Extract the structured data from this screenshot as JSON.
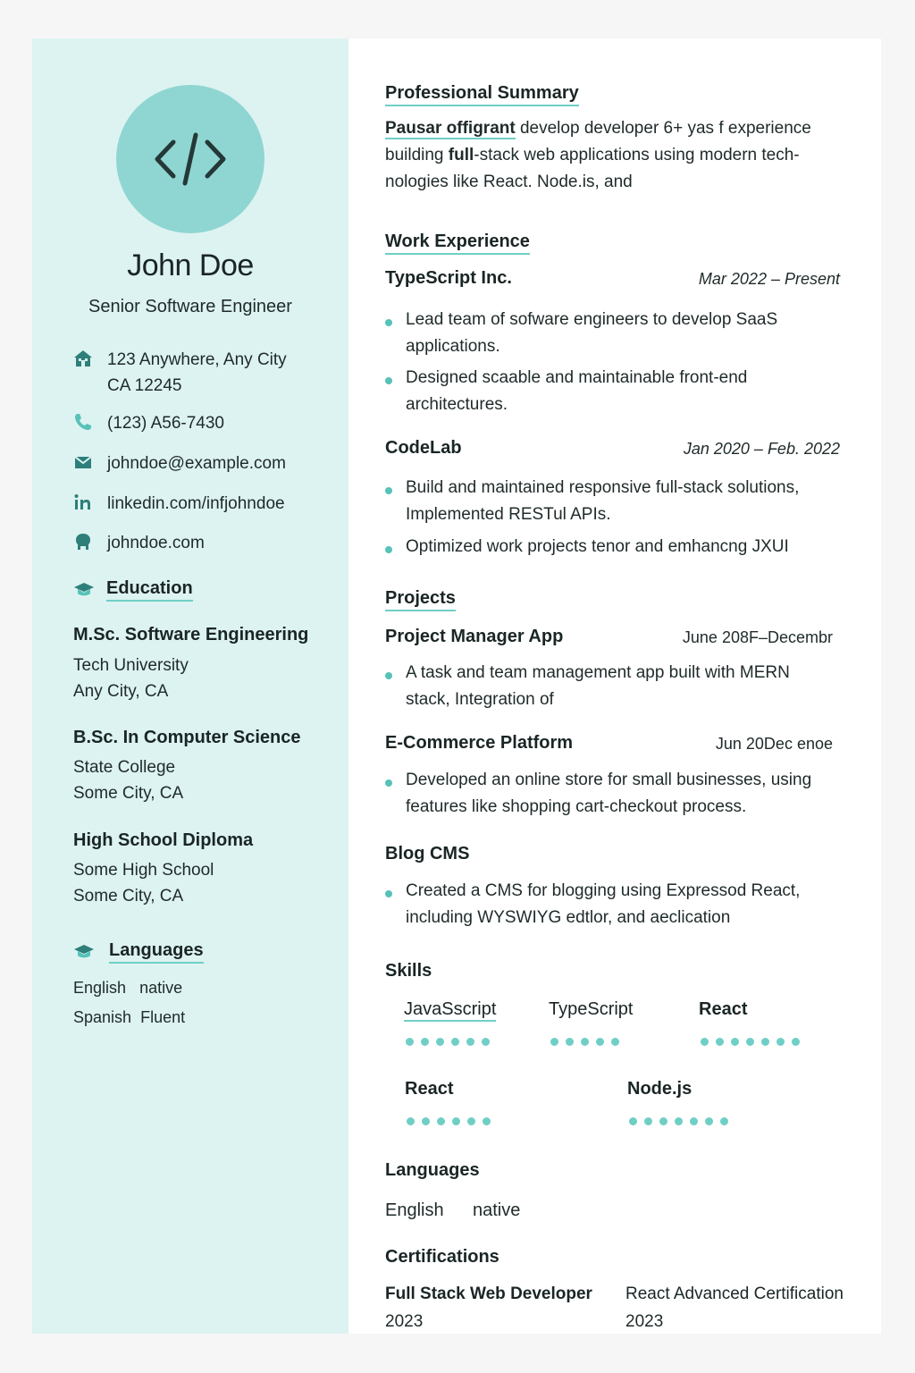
{
  "profile": {
    "name": "John Doe",
    "title": "Senior Software Engineer",
    "avatar_icon": "code-brackets-icon"
  },
  "contact": {
    "address_line1": "123 Anywhere, Any City",
    "address_line2": "CA 12245",
    "phone": "(123) A56-7430",
    "email": "johndoe@example.com",
    "linkedin": "linkedin.com/infjohndoe",
    "website": "johndoe.com"
  },
  "education": {
    "heading": "Education",
    "items": [
      {
        "degree": "M.Sc. Software Engineering",
        "school": "Tech University",
        "location": "Any City, CA"
      },
      {
        "degree": "B.Sc. In Computer Science",
        "school": "State College",
        "location": "Some City, CA"
      },
      {
        "degree": "High School Diploma",
        "school": "Some High School",
        "location": "Some City, CA"
      }
    ]
  },
  "side_languages": {
    "heading": "Languages",
    "items": [
      {
        "language": "English",
        "level": "native"
      },
      {
        "language": "Spanish",
        "level": "Fluent"
      }
    ]
  },
  "summary": {
    "heading": "Professional Summary",
    "highlight": "Pausar offigrant",
    "line1_rest": " develop developer 6+ yas f experience",
    "line2_pre": "building ",
    "line2_bold": "full",
    "line2_rest": "-stack web applications using modern tech-",
    "line3": "nologies like React. Node.is, and"
  },
  "experience": {
    "heading": "Work Experience",
    "jobs": [
      {
        "company": "TypeScript Inc.",
        "dates": "Mar 2022  – Present",
        "bullets": [
          [
            "Lead team of sofware engineers to develop SaaS",
            "applications."
          ],
          [
            "Designed scaable and maintainable front-end",
            "architectures."
          ]
        ]
      },
      {
        "company": "CodeLab",
        "dates": "Jan 2020  – Feb. 2022",
        "bullets": [
          [
            "Build and maintained responsive full-stack solutions,",
            "Implemented RESTul APIs."
          ],
          [
            "Optimized work projects tenor and emhancng JXUI"
          ]
        ]
      }
    ]
  },
  "projects": {
    "heading": "Projects",
    "items": [
      {
        "name": "Project Manager App",
        "dates": "June 208F–Decembr",
        "lines": [
          "A task and team management app built with MERN",
          "stack, Integration of"
        ]
      },
      {
        "name": "E-Commerce Platform",
        "dates": "Jun 20Dec enoe",
        "lines": [
          "Developed an online store for small businesses, using",
          "features like shopping cart-checkout process."
        ]
      },
      {
        "name": "Blog CMS",
        "dates": "",
        "lines": [
          "Created a  CMS  for  blogging using Expressod React,",
          "including WYSWIYG edtlor, and aeclication"
        ]
      }
    ]
  },
  "skills": {
    "heading": "Skills",
    "items": [
      {
        "name": "JavaSscript",
        "dots": 6
      },
      {
        "name": "TypeScript",
        "dots": 5
      },
      {
        "name": "React",
        "dots": 7
      },
      {
        "name": "React",
        "dots": 6
      },
      {
        "name": "Node.js",
        "dots": 7
      }
    ]
  },
  "main_languages": {
    "heading": "Languages",
    "language": "English",
    "level": "native"
  },
  "certifications": {
    "heading": "Certifications",
    "items": [
      {
        "name": "Full Stack Web Developer",
        "year": "2023"
      },
      {
        "name": "React Advanced Certification",
        "year": "2023"
      }
    ]
  },
  "colors": {
    "sidebar_bg": "#ddf3f1",
    "accent": "#6fcfc6",
    "avatar": "#8fd6d2",
    "icon": "#2e7f7a"
  }
}
